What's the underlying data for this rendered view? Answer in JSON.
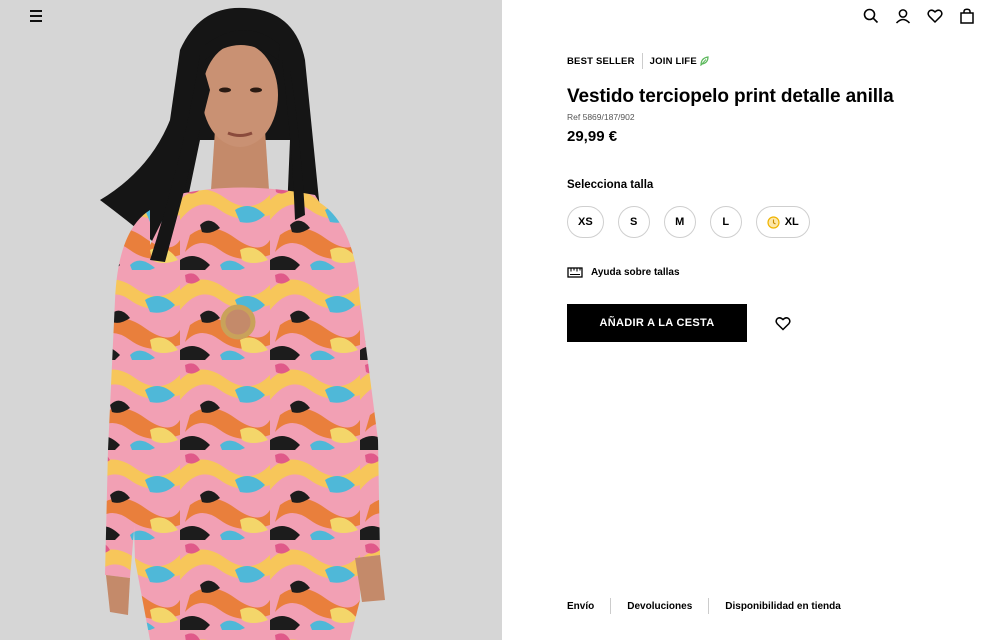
{
  "header": {
    "icons": [
      "menu-icon",
      "search-icon",
      "user-icon",
      "heart-icon",
      "bag-icon"
    ]
  },
  "product": {
    "tags": [
      "BEST SELLER",
      "JOIN LIFE"
    ],
    "title": "Vestido terciopelo print detalle anilla",
    "ref": "Ref 5869/187/902",
    "price": "29,99 €",
    "size_label": "Selecciona talla",
    "sizes": [
      "XS",
      "S",
      "M",
      "L",
      "XL"
    ],
    "size_help": "Ayuda sobre tallas",
    "add_to_cart": "AÑADIR A LA CESTA"
  },
  "footer": {
    "links": [
      "Envío",
      "Devoluciones",
      "Disponibilidad en tienda"
    ]
  },
  "colors": {
    "accent": "#000000",
    "join_life_leaf": "#5cb85c",
    "clock_icon": "#f0b400"
  }
}
